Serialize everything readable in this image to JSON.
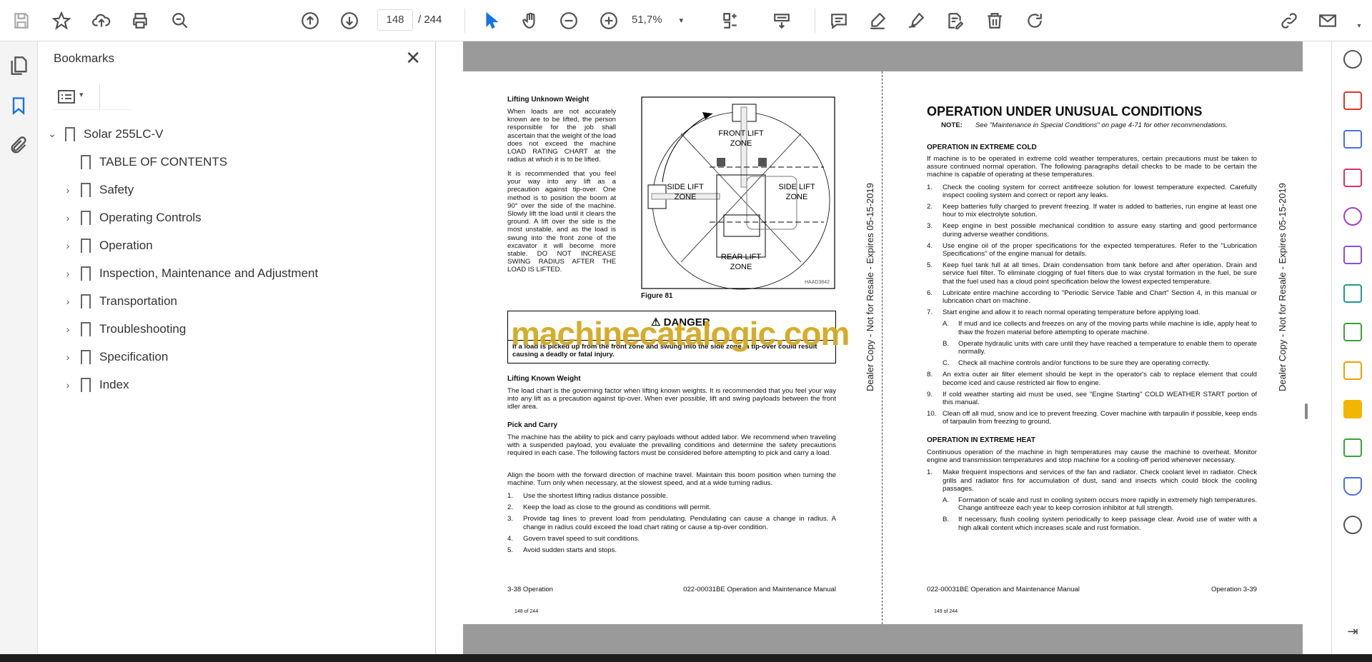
{
  "toolbar": {
    "page_current": "148",
    "page_total": "/ 244",
    "zoom": "51,7%"
  },
  "icons": {
    "save": "save-icon",
    "bookmark": "star-icon",
    "upload": "upload-icon",
    "print": "print-icon",
    "find": "search-zoom-icon",
    "prev": "arrow-up-circle-icon",
    "next": "arrow-down-circle-icon",
    "select": "cursor-icon",
    "hand": "hand-icon",
    "zoom_out": "minus-circle-icon",
    "zoom_in": "plus-circle-icon",
    "fit": "fit-page-icon",
    "scroll": "keyboard-icon",
    "comment": "comment-icon",
    "highlight": "pen-icon",
    "sign": "sign-icon",
    "fill": "fill-sign-icon",
    "delete": "trash-icon",
    "rotate": "rotate-icon",
    "link": "link-icon",
    "mail": "mail-icon"
  },
  "bookmarks": {
    "title": "Bookmarks",
    "items": [
      {
        "label": "Solar 255LC-V",
        "level": 0,
        "expanded": true
      },
      {
        "label": "TABLE OF CONTENTS",
        "level": 1,
        "children": false
      },
      {
        "label": "Safety",
        "level": 1,
        "children": true
      },
      {
        "label": "Operating Controls",
        "level": 1,
        "children": true
      },
      {
        "label": "Operation",
        "level": 1,
        "children": true
      },
      {
        "label": "Inspection, Maintenance and Adjustment",
        "level": 1,
        "children": true
      },
      {
        "label": "Transportation",
        "level": 1,
        "children": true
      },
      {
        "label": "Troubleshooting",
        "level": 1,
        "children": true
      },
      {
        "label": "Specification",
        "level": 1,
        "children": true
      },
      {
        "label": "Index",
        "level": 1,
        "children": true
      }
    ]
  },
  "watermark": "machinecatalogic.com",
  "dealer_stamp": "Dealer Copy - Not for Resale - Expires 05-15-2019",
  "left_page": {
    "h1": "Lifting Unknown Weight",
    "p1": "When loads are not accurately known are to be lifted, the person responsible for the job shall ascertain that the weight of the load does not exceed the machine LOAD RATING CHART at the radius at which it is to be lifted.",
    "p2": "It is recommended that you feel your way into any lift as a precaution against tip-over. One method is to position the boom at 90° over the side of the machine. Slowly lift the load until it clears the ground. A lift over the side is the most unstable, and as the load is swung into the front zone of the excavator it will become more stable. DO NOT INCREASE SWING RADIUS AFTER THE LOAD IS LIFTED.",
    "figure": {
      "front": "FRONT LIFT",
      "side": "SIDE LIFT",
      "rear": "REAR LIFT",
      "zone": "ZONE",
      "code": "HAAD3842",
      "caption": "Figure 81"
    },
    "danger_title": "DANGER",
    "danger_text": "If a load is picked up from the front zone and swung into the side zone, a tip-over could result causing a deadly or fatal injury.",
    "h2": "Lifting Known Weight",
    "p3": "The load chart is the governing factor when lifting known weights. It is recommended that you feel your way into any lift as a precaution against tip-over. When ever possible, lift and swing payloads between the front idler area.",
    "h3": "Pick and Carry",
    "p4": "The machine has the ability to pick and carry payloads without added labor. We recommend when traveling with a suspended payload, you evaluate the prevailing conditions and determine the safety precautions required in each case. The following factors must be considered before attempting to pick and carry a load.",
    "p5": "Align the boom with the forward direction of machine travel. Maintain this boom position when turning the machine. Turn only when necessary, at the slowest speed, and at a wide turning radius.",
    "list": [
      [
        "1.",
        "Use the shortest lifting radius distance possible."
      ],
      [
        "2.",
        "Keep the load as close to the ground as conditions will permit."
      ],
      [
        "3.",
        "Provide tag lines to prevent load from pendulating. Pendulating can cause a change in radius. A change in radius could exceed the load chart rating or cause a tip-over condition."
      ],
      [
        "4.",
        "Govern travel speed to suit conditions."
      ],
      [
        "5.",
        "Avoid sudden starts and stops."
      ]
    ],
    "footer_left": "3-38  Operation",
    "footer_right": "022-00031BE Operation and Maintenance Manual",
    "page_of": "148 of 244"
  },
  "right_page": {
    "title": "OPERATION UNDER UNUSUAL CONDITIONS",
    "note_label": "NOTE:",
    "note": "See \"Maintenance in Special Conditions\" on page 4-71 for other recommendations.",
    "h1": "OPERATION IN EXTREME COLD",
    "p1": "If machine is to be operated in extreme cold weather temperatures, certain precautions must be taken to assure continued normal operation. The following paragraphs detail checks to be made to be certain the machine is capable of operating at these temperatures.",
    "cold": [
      [
        "1.",
        "Check the cooling system for correct antifreeze solution for lowest temperature expected. Carefully inspect cooling system and correct or report any leaks."
      ],
      [
        "2.",
        "Keep batteries fully charged to prevent freezing. If water is added to batteries, run engine at least one hour to mix electrolyte solution."
      ],
      [
        "3.",
        "Keep engine in best possible mechanical condition to assure easy starting and good performance during adverse weather conditions."
      ],
      [
        "4.",
        "Use engine oil of the proper specifications for the expected temperatures. Refer to the \"Lubrication Specifications\" of the engine manual for details."
      ],
      [
        "5.",
        "Keep fuel tank full at all times. Drain condensation from tank before and after operation. Drain and service fuel filter. To eliminate clogging of fuel filters due to wax crystal formation in the fuel, be sure that the fuel used has a cloud point specification below the lowest expected temperature."
      ],
      [
        "6.",
        "Lubricate entire machine according to \"Periodic Service Table and Chart\" Section 4, in this manual or lubrication chart on machine."
      ],
      [
        "7.",
        "Start engine and allow it to reach normal operating temperature before applying load."
      ]
    ],
    "cold_sub": [
      [
        "A.",
        "If mud and ice collects and freezes on any of the moving parts while machine is idle, apply heat to thaw the frozen material before attempting to operate machine."
      ],
      [
        "B.",
        "Operate hydraulic units with care until they have reached a temperature to enable them to operate normally."
      ],
      [
        "C.",
        "Check all machine controls and/or functions to be sure they are operating correctly."
      ]
    ],
    "cold2": [
      [
        "8.",
        "An extra outer air filter element should be kept in the operator's cab to replace element that could become iced and cause restricted air flow to engine."
      ],
      [
        "9.",
        "If cold weather starting aid must be used, see \"Engine Starting\" COLD WEATHER START portion of this manual."
      ],
      [
        "10.",
        "Clean off all mud, snow and ice to prevent freezing. Cover machine with tarpaulin if possible, keep ends of tarpaulin from freezing to ground."
      ]
    ],
    "h2": "OPERATION IN EXTREME HEAT",
    "p2": "Continuous operation of the machine in high temperatures may cause the machine to overheat. Monitor engine and transmission temperatures and stop machine for a cooling-off period whenever necessary.",
    "heat": [
      [
        "1.",
        "Make frequent inspections and services of the fan and radiator. Check coolant level in radiator. Check grills and radiator fins for accumulation of dust, sand and insects which could block the cooling passages."
      ]
    ],
    "heat_sub": [
      [
        "A.",
        "Formation of scale and rust in cooling system occurs more rapidly in extremely high temperatures. Change antifreeze each year to keep corrosion inhibitor at full strength."
      ],
      [
        "B.",
        "If necessary, flush cooling system periodically to keep passage clear. Avoid use of water with a high alkali content which increases scale and rust formation."
      ]
    ],
    "footer_left": "022-00031BE Operation and Maintenance Manual",
    "footer_right": "Operation 3-39",
    "page_of": "149 of 244"
  }
}
